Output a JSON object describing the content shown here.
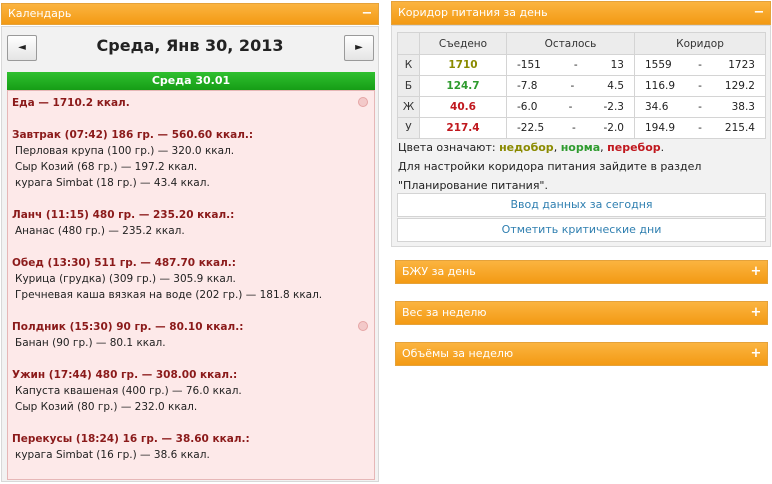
{
  "calendar": {
    "title": "Календарь",
    "collapse_icon": "−",
    "prev_label": "◄",
    "next_label": "►",
    "date_title": "Среда, Янв 30, 2013",
    "day_bar": "Среда 30.01",
    "lines": [
      {
        "type": "total",
        "text": "Еда — 1710.2 ккал."
      },
      {
        "type": "gap",
        "text": ""
      },
      {
        "type": "total",
        "text": "Завтрак (07:42) 186 гр. — 560.60 ккал.:"
      },
      {
        "type": "item",
        "text": "Перловая крупа (100 гр.) — 320.0 ккал."
      },
      {
        "type": "item",
        "text": "Сыр Козий (68 гр.) — 197.2 ккал."
      },
      {
        "type": "item",
        "text": "курага Simbat (18 гр.) — 43.4 ккал."
      },
      {
        "type": "gap",
        "text": ""
      },
      {
        "type": "total",
        "text": "Ланч (11:15) 480 гр. — 235.20 ккал.:"
      },
      {
        "type": "item",
        "text": "Ананас (480 гр.) — 235.2 ккал."
      },
      {
        "type": "gap",
        "text": ""
      },
      {
        "type": "total",
        "text": "Обед (13:30) 511 гр. — 487.70 ккал.:"
      },
      {
        "type": "item",
        "text": "Курица (грудка) (309 гр.) — 305.9 ккал."
      },
      {
        "type": "item",
        "text": "Гречневая каша вязкая на воде (202 гр.) — 181.8 ккал."
      },
      {
        "type": "gap",
        "text": ""
      },
      {
        "type": "total",
        "text": "Полдник (15:30) 90 гр. — 80.10 ккал.:"
      },
      {
        "type": "item",
        "text": "Банан (90 гр.) — 80.1 ккал."
      },
      {
        "type": "gap",
        "text": ""
      },
      {
        "type": "total",
        "text": "Ужин (17:44) 480 гр. — 308.00 ккал.:"
      },
      {
        "type": "item",
        "text": "Капуста квашеная (400 гр.) — 76.0 ккал."
      },
      {
        "type": "item",
        "text": "Сыр Козий (80 гр.) — 232.0 ккал."
      },
      {
        "type": "gap",
        "text": ""
      },
      {
        "type": "total",
        "text": "Перекусы (18:24) 16 гр. — 38.60 ккал.:"
      },
      {
        "type": "item",
        "text": "курага Simbat (16 гр.) — 38.6 ккал."
      }
    ]
  },
  "corridor": {
    "title": "Коридор питания за день",
    "collapse_icon": "−",
    "headers": [
      "Съедено",
      "Осталось",
      "Коридор"
    ],
    "rows": [
      {
        "label": "К",
        "eaten": "1710",
        "eaten_color": "#8a8a00",
        "left_min": "-151",
        "left_max": "13",
        "range_min": "1559",
        "range_max": "1723"
      },
      {
        "label": "Б",
        "eaten": "124.7",
        "eaten_color": "#2e9b2e",
        "left_min": "-7.8",
        "left_max": "4.5",
        "range_min": "116.9",
        "range_max": "129.2"
      },
      {
        "label": "Ж",
        "eaten": "40.6",
        "eaten_color": "#c0181e",
        "left_min": "-6.0",
        "left_max": "-2.3",
        "range_min": "34.6",
        "range_max": "38.3"
      },
      {
        "label": "У",
        "eaten": "217.4",
        "eaten_color": "#c0181e",
        "left_min": "-22.5",
        "left_max": "-2.0",
        "range_min": "194.9",
        "range_max": "215.4"
      }
    ],
    "dash": "-",
    "legend_prefix": "Цвета означают:",
    "legend_under": "недобор",
    "legend_norm": "норма",
    "legend_over": "перебор",
    "note_line1": "Для настройки коридора питания зайдите в раздел",
    "note_line2": "\"Планирование питания\".",
    "btn_today": "Ввод данных за сегодня",
    "btn_critical": "Отметить критические дни"
  },
  "collapsed_panels": [
    {
      "title": "БЖУ за день",
      "expand_icon": "+"
    },
    {
      "title": "Вес за неделю",
      "expand_icon": "+"
    },
    {
      "title": "Объёмы за неделю",
      "expand_icon": "+"
    }
  ],
  "colors": {
    "header_orange": "#f39a14",
    "day_green": "#169d16",
    "meals_bg": "#fde9e9",
    "under": "#8a8a00",
    "norm": "#2e9b2e",
    "over": "#c0181e",
    "link": "#2f7fb0"
  }
}
